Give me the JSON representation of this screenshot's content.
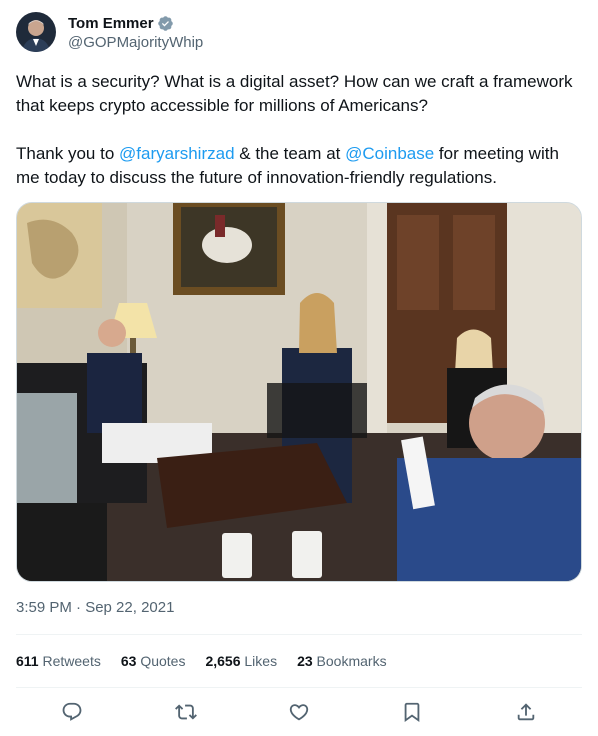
{
  "author": {
    "display_name": "Tom Emmer",
    "handle": "@GOPMajorityWhip",
    "verified_icon": "verified-badge-icon"
  },
  "tweet": {
    "line1": "What is a security? What is a digital asset? How can we craft a framework that keeps crypto accessible for millions of Americans?",
    "line2_part1": "Thank you to ",
    "mention1": "@faryarshirzad",
    "line2_part2": " & the team at ",
    "mention2": "@Coinbase",
    "line2_part3": " for meeting with me today to discuss the future of innovation-friendly regulations."
  },
  "timestamp": "3:59 PM · Sep 22, 2021",
  "stats": {
    "retweets_count": "611",
    "retweets_label": "Retweets",
    "quotes_count": "63",
    "quotes_label": "Quotes",
    "likes_count": "2,656",
    "likes_label": "Likes",
    "bookmarks_count": "23",
    "bookmarks_label": "Bookmarks"
  },
  "actions": {
    "reply_icon": "reply-icon",
    "retweet_icon": "retweet-icon",
    "like_icon": "heart-icon",
    "bookmark_icon": "bookmark-icon",
    "share_icon": "share-icon"
  },
  "colors": {
    "link": "#1d9bf0",
    "secondary_text": "#536471",
    "primary_text": "#0f1419",
    "verified": "#829aab"
  }
}
